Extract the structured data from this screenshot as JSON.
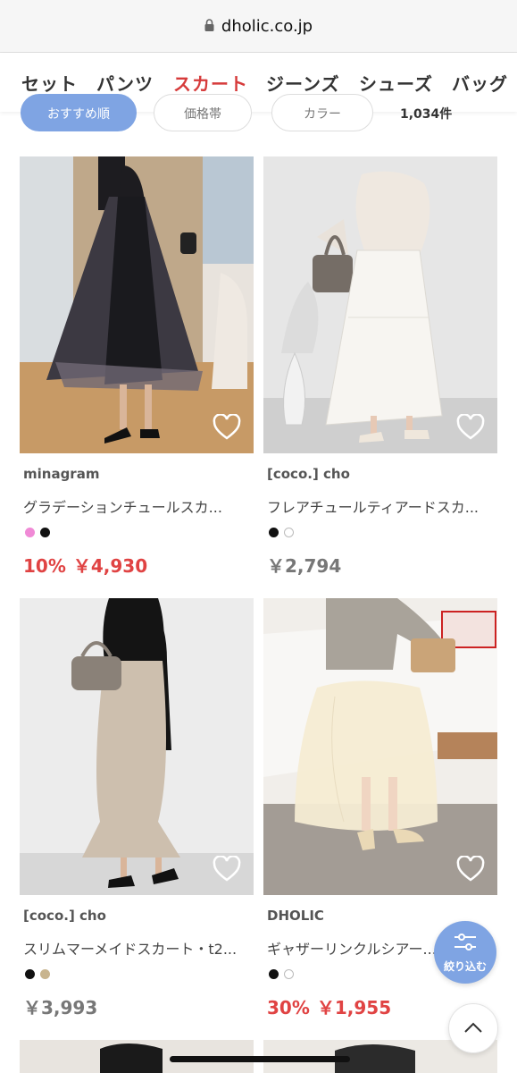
{
  "browser": {
    "url": "dholic.co.jp"
  },
  "categories": [
    {
      "label": "セット",
      "active": false
    },
    {
      "label": "パンツ",
      "active": false
    },
    {
      "label": "スカート",
      "active": true
    },
    {
      "label": "ジーンズ",
      "active": false
    },
    {
      "label": "シューズ",
      "active": false
    },
    {
      "label": "バッグ",
      "active": false
    }
  ],
  "filters": {
    "chip1": "おすすめ順",
    "chip2": "価格帯",
    "chip3": "カラー",
    "count": "1,034件"
  },
  "products": [
    {
      "brand": "minagram",
      "name": "グラデーションチュールスカ...",
      "swatches": [
        "#f08ad6",
        "#111111"
      ],
      "discount": "10%",
      "price": "￥4,930"
    },
    {
      "brand": "[coco.] cho",
      "name": "フレアチュールティアードスカ...",
      "swatches": [
        "#111111",
        "#ffffff"
      ],
      "discount": "",
      "price": "￥2,794"
    },
    {
      "brand": "[coco.] cho",
      "name": "スリムマーメイドスカート・t2...",
      "swatches": [
        "#111111",
        "#c8b48e"
      ],
      "discount": "",
      "price": "￥3,993"
    },
    {
      "brand": "DHOLIC",
      "name": "ギャザーリンクルシアー...",
      "swatches": [
        "#111111",
        "#ffffff"
      ],
      "discount": "30%",
      "price": "￥1,955"
    }
  ],
  "fab": {
    "filter_label": "絞り込む"
  },
  "colors": {
    "accent": "#d63b3b",
    "sale": "#e04343",
    "blue": "#7fa4e3"
  }
}
